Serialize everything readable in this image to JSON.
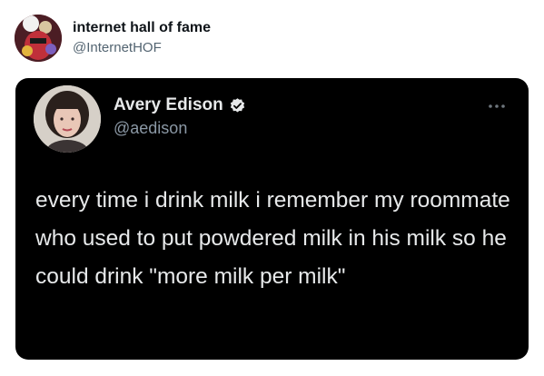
{
  "outer": {
    "display_name": "internet hall of fame",
    "handle": "@InternetHOF"
  },
  "embedded": {
    "display_name": "Avery Edison",
    "handle": "@aedison",
    "verified_icon": "verified-badge",
    "more_icon": "more-dots",
    "text": "every time i drink milk i remember my roommate who used to put powdered milk in his milk so he could drink \"more milk per milk\""
  },
  "colors": {
    "card_background": "#000000",
    "text_primary": "#e7e9ea",
    "text_secondary": "#8b98a5"
  }
}
